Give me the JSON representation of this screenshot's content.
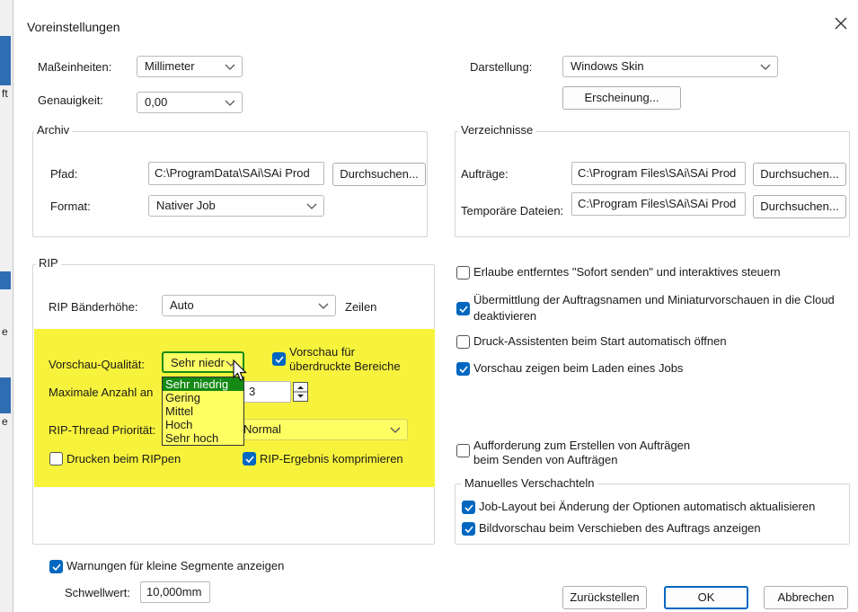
{
  "dialog": {
    "title": "Voreinstellungen",
    "close_glyph": "✕"
  },
  "background_fragments": [
    "ft",
    "e",
    "l",
    "e"
  ],
  "units": {
    "label": "Maßeinheiten:",
    "value": "Millimeter"
  },
  "precision": {
    "label": "Genauigkeit:",
    "value": "0,00"
  },
  "display": {
    "label": "Darstellung:",
    "value": "Windows Skin",
    "appearance_button": "Erscheinung..."
  },
  "archive": {
    "title": "Archiv",
    "path_label": "Pfad:",
    "path_value": "C:\\ProgramData\\SAi\\SAi Prod",
    "browse_button": "Durchsuchen...",
    "format_label": "Format:",
    "format_value": "Nativer Job"
  },
  "directories": {
    "title": "Verzeichnisse",
    "jobs_label": "Aufträge:",
    "jobs_value": "C:\\Program Files\\SAi\\SAi Prod",
    "jobs_browse": "Durchsuchen...",
    "temp_label": "Temporäre Dateien:",
    "temp_value": "C:\\Program Files\\SAi\\SAi Prod",
    "temp_browse": "Durchsuchen..."
  },
  "rip": {
    "title": "RIP",
    "band_height_label": "RIP Bänderhöhe:",
    "band_height_value": "Auto",
    "band_height_unit": "Zeilen",
    "preview_quality_label": "Vorschau-Qualität:",
    "preview_quality_value": "Sehr niedr",
    "preview_quality_options": [
      "Sehr niedrig",
      "Gering",
      "Mittel",
      "Hoch",
      "Sehr hoch"
    ],
    "preview_quality_selected_index": 0,
    "max_count_label": "Maximale Anzahl an",
    "max_count_value": "3",
    "thread_priority_label": "RIP-Thread Priorität:",
    "thread_priority_value": "Normal",
    "overprint_preview_label_line1": "Vorschau für",
    "overprint_preview_label_line2": "überdruckte Bereiche",
    "overprint_preview_checked": true,
    "print_while_rip_label": "Drucken beim RIPpen",
    "print_while_rip_checked": false,
    "compress_result_label": "RIP-Ergebnis komprimieren",
    "compress_result_checked": true,
    "highlight_color": "#f7f33c"
  },
  "options": {
    "remote_send": {
      "label": "Erlaube entferntes \"Sofort senden\" und interaktives steuern",
      "checked": false
    },
    "cloud_line1": "Übermittlung der Auftragsnamen und Miniaturvorschauen in die Cloud",
    "cloud_line2": "deaktivieren",
    "cloud_checked": true,
    "print_assistant": {
      "label": "Druck-Assistenten beim Start automatisch öffnen",
      "checked": false
    },
    "show_preview": {
      "label": "Vorschau zeigen beim Laden eines Jobs",
      "checked": true
    },
    "request_line1": "Aufforderung zum Erstellen von Aufträgen",
    "request_line2": "beim Senden von Aufträgen",
    "request_checked": false
  },
  "nesting": {
    "title": "Manuelles Verschachteln",
    "auto_update": {
      "label": "Job-Layout bei Änderung der Optionen automatisch aktualisieren",
      "checked": true
    },
    "image_preview": {
      "label": "Bildvorschau beim Verschieben des Auftrags anzeigen",
      "checked": true
    }
  },
  "warnings": {
    "label": "Warnungen für kleine Segmente anzeigen",
    "checked": true,
    "threshold_label": "Schwellwert:",
    "threshold_value": "10,000mm"
  },
  "footer": {
    "reset": "Zurückstellen",
    "ok": "OK",
    "cancel": "Abbrechen"
  },
  "colors": {
    "accent": "#0067c0",
    "dropdown_selected": "#148a14",
    "dropdown_bg": "#fffe63"
  }
}
